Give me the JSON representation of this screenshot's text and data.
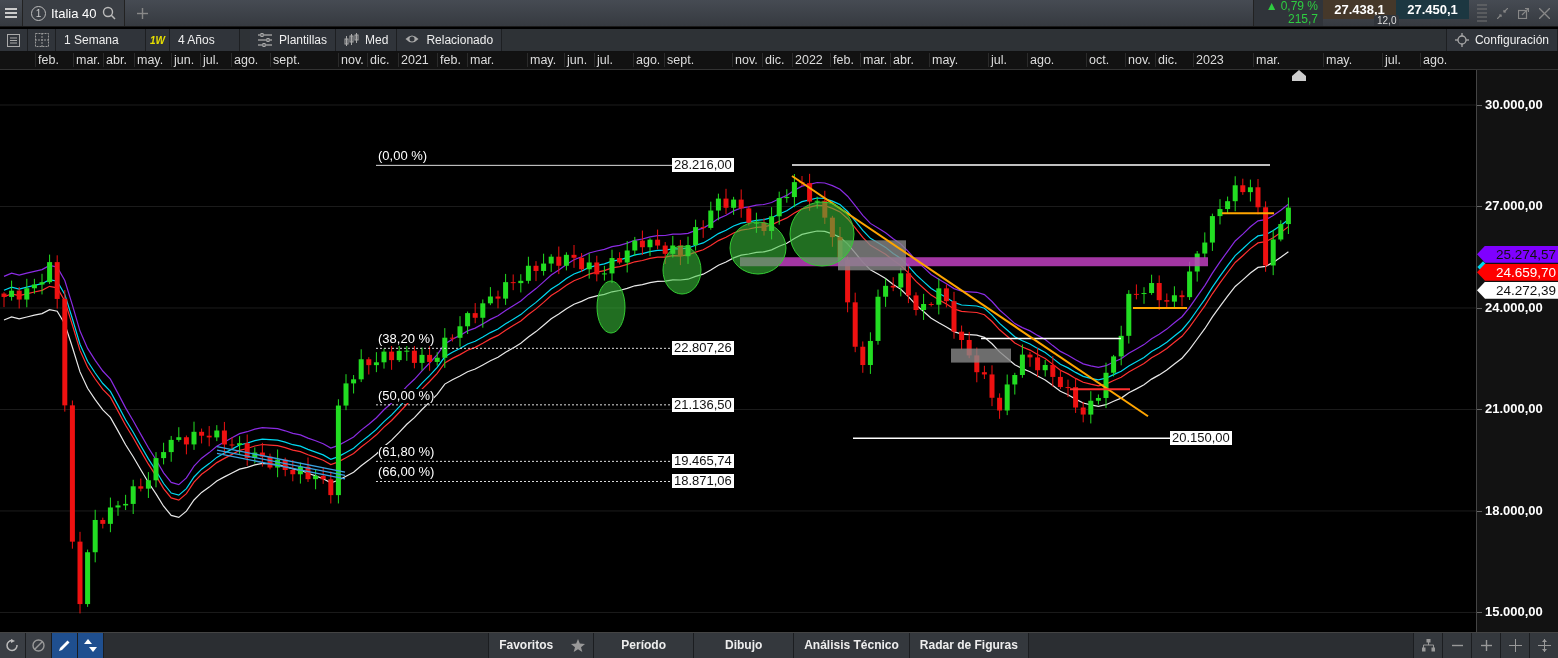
{
  "top_bar": {
    "tab": {
      "number": "1",
      "label": "Italia 40"
    },
    "quote": {
      "change_arrow": "▲",
      "change": "0,79 %",
      "points": "215,7",
      "sell": "27.438,1",
      "buy": "27.450,1",
      "spread": "12,0"
    }
  },
  "toolbar": {
    "interval": "1 Semana",
    "interval_badge": "1W",
    "range": "4 Años",
    "buttons": [
      {
        "kind": "templates",
        "label": "Plantillas"
      },
      {
        "kind": "indicators",
        "label": "Med"
      },
      {
        "kind": "related",
        "label": "Relacionado"
      }
    ],
    "settings": "Configuración"
  },
  "time_axis": [
    "feb.",
    "mar.",
    "abr.",
    "may.",
    "jun.",
    "jul.",
    "ago.",
    "sept.",
    "nov.",
    "dic.",
    "2021",
    "feb.",
    "mar.",
    "may.",
    "jun.",
    "jul.",
    "ago.",
    "sept.",
    "nov.",
    "dic.",
    "2022",
    "feb.",
    "mar.",
    "abr.",
    "may.",
    "jul.",
    "ago.",
    "oct.",
    "nov.",
    "dic.",
    "2023",
    "mar.",
    "may.",
    "jul.",
    "ago."
  ],
  "chart": {
    "fibonacci": [
      {
        "label": "(0,00 %)",
        "value": "28.216,00"
      },
      {
        "label": "(38,20 %)",
        "value": "22.807,26"
      },
      {
        "label": "(50,00 %)",
        "value": "21.136,50"
      },
      {
        "label": "(61,80 %)",
        "value": "19.465,74"
      },
      {
        "label": "(66,00 %)",
        "value": "18.871,06"
      }
    ],
    "support_label": "20.150,00",
    "price_axis": [
      "30.000,00",
      "27.000,00",
      "24.000,00",
      "21.000,00",
      "18.000,00",
      "15.000,00"
    ],
    "price_tags": [
      {
        "kind": "tag",
        "value": "25.274,57",
        "color": "#7f00ff"
      },
      {
        "kind": "marker",
        "color": "#00d8f0"
      },
      {
        "kind": "tag",
        "value": "24.659,70",
        "color": "#ff0000"
      },
      {
        "kind": "tag",
        "value": "24.272,39",
        "color": "#ffffff"
      }
    ]
  },
  "bottom_bar": {
    "tools": [
      {
        "kind": "reset",
        "selected": false
      },
      {
        "kind": "clear",
        "selected": false
      },
      {
        "kind": "pencil",
        "selected": true
      },
      {
        "kind": "arrows",
        "selected": true
      }
    ],
    "menus": [
      "Favoritos",
      "Período",
      "Dibujo",
      "Análisis Técnico",
      "Radar de Figuras"
    ]
  }
}
